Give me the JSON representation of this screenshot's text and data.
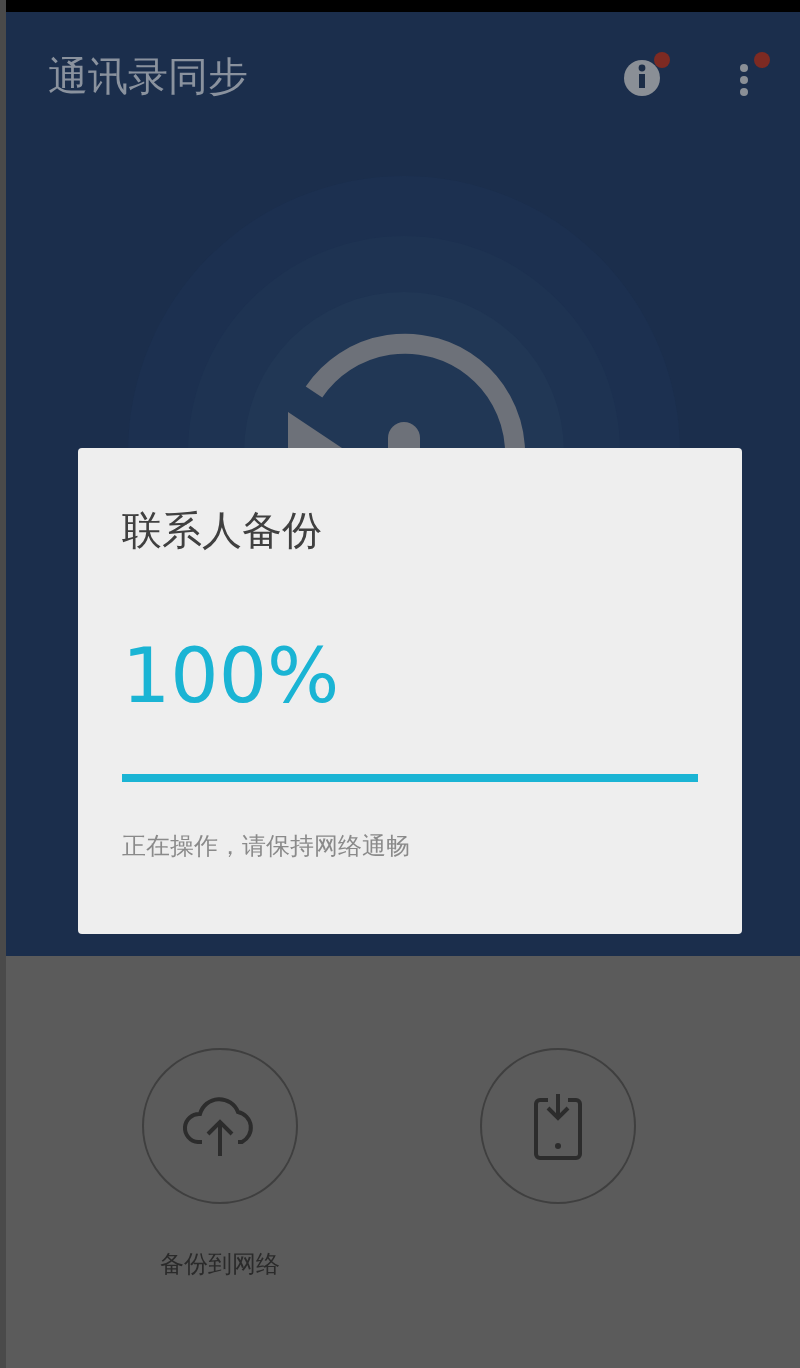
{
  "app_bar": {
    "title": "通讯录同步"
  },
  "dialog": {
    "title": "联系人备份",
    "percent": "100%",
    "progress": {
      "level": 1
    },
    "message": "正在操作，请保持网络通畅"
  },
  "actions": [
    {
      "kind": "cloud-upload",
      "label": "备份到网络"
    },
    {
      "kind": "phone-download"
    }
  ]
}
